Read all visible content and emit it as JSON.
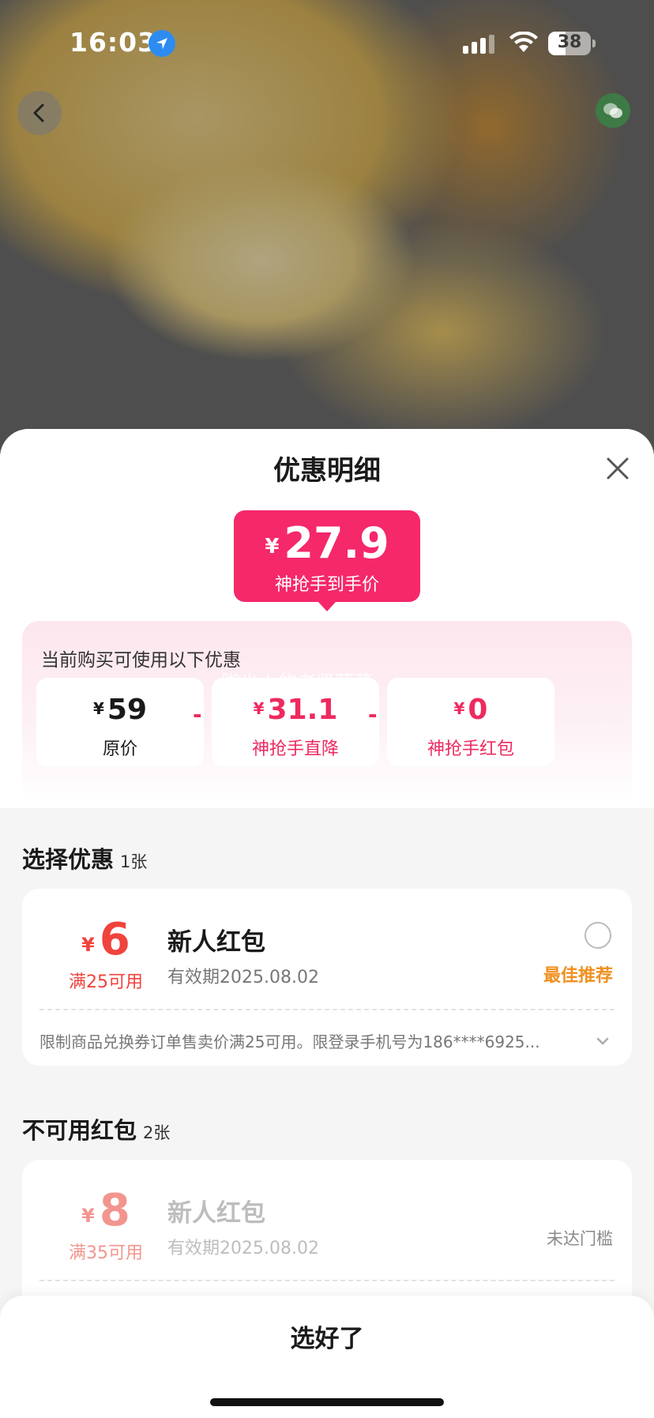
{
  "status_bar": {
    "time": "16:03",
    "battery": "38"
  },
  "sheet": {
    "title": "优惠明细",
    "final_price": {
      "currency": "¥",
      "amount": "27.9",
      "label": "神抢手到手价"
    },
    "breakdown": {
      "caption": "当前购买可使用以下优惠",
      "watermark": "脚尖上的老贤蔬菜",
      "operator": "-",
      "items": [
        {
          "currency": "¥",
          "value": "59",
          "label": "原价"
        },
        {
          "currency": "¥",
          "value": "31.1",
          "label": "神抢手直降"
        },
        {
          "currency": "¥",
          "value": "0",
          "label": "神抢手红包"
        }
      ]
    },
    "select_section": {
      "title": "选择优惠",
      "count": "1张"
    },
    "available_coupon": {
      "currency": "¥",
      "amount": "6",
      "condition": "满25可用",
      "name": "新人红包",
      "validity": "有效期2025.08.02",
      "tag": "最佳推荐",
      "description": "限制商品兑换券订单售卖价满25可用。限登录手机号为186****6925..."
    },
    "unavailable_section": {
      "title": "不可用红包",
      "count": "2张"
    },
    "unavailable_coupon": {
      "currency": "¥",
      "amount": "8",
      "condition": "满35可用",
      "name": "新人红包",
      "validity": "有效期2025.08.02",
      "status": "未达门槛"
    },
    "confirm_label": "选好了"
  },
  "colors": {
    "accent_pink": "#f5286a",
    "coupon_red": "#f0433c",
    "recommend_orange": "#f0901e"
  }
}
